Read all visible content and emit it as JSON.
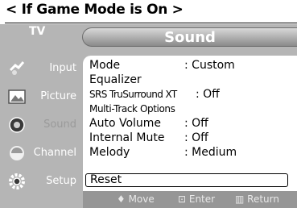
{
  "caption": "< If Game Mode is On >",
  "tv_label": "TV",
  "title": "Sound",
  "sidebar": [
    {
      "label": "Input",
      "icon": "input-icon"
    },
    {
      "label": "Picture",
      "icon": "picture-icon"
    },
    {
      "label": "Sound",
      "icon": "sound-icon",
      "active": true
    },
    {
      "label": "Channel",
      "icon": "channel-icon"
    },
    {
      "label": "Setup",
      "icon": "setup-icon"
    }
  ],
  "menu": [
    {
      "label": "Mode",
      "value": ": Custom"
    },
    {
      "label": "Equalizer",
      "value": ""
    },
    {
      "label": "SRS TruSurround XT",
      "value": ": Off"
    },
    {
      "label": "Multi-Track Options",
      "value": ""
    },
    {
      "label": "Auto Volume",
      "value": ": Off"
    },
    {
      "label": "Internal Mute",
      "value": ": Off"
    },
    {
      "label": "Melody",
      "value": ": Medium"
    },
    {
      "label": "Reset",
      "value": ""
    }
  ],
  "footer": {
    "move": "♦ Move",
    "enter": "⊡ Enter",
    "return": "▥ Return"
  }
}
